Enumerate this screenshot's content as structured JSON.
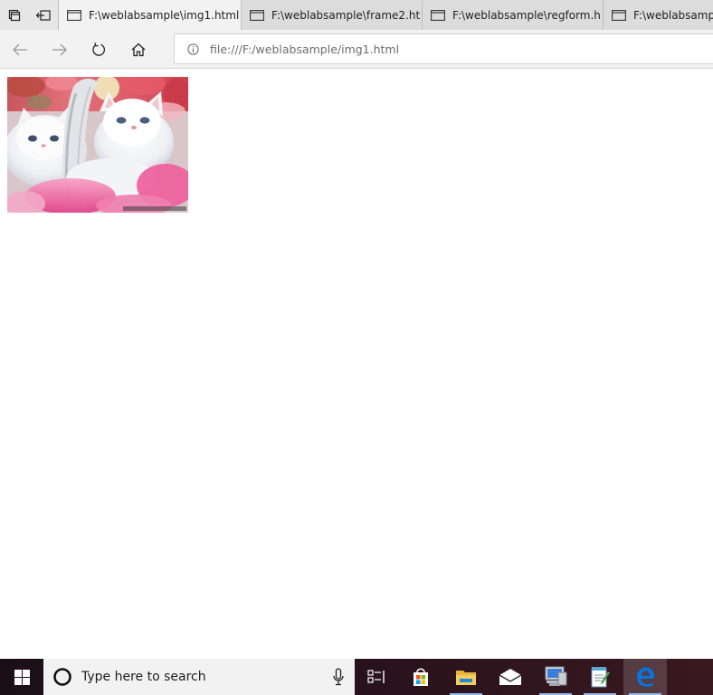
{
  "browser": {
    "tabs": [
      {
        "label": "F:\\weblabsample\\img1.html",
        "active": true
      },
      {
        "label": "F:\\weblabsample\\frame2.ht",
        "active": false
      },
      {
        "label": "F:\\weblabsample\\regform.h",
        "active": false
      },
      {
        "label": "F:\\weblabsamp",
        "active": false
      }
    ],
    "tab_strip_icons": [
      "tab-manager-icon",
      "set-aside-tabs-icon"
    ],
    "nav_icons": [
      "back-arrow-icon",
      "forward-arrow-icon",
      "refresh-icon",
      "home-icon"
    ],
    "address": {
      "icon": "info-icon",
      "url": "file:///F:/weblabsample/img1.html"
    }
  },
  "page": {
    "image": "white-kittens-in-basket"
  },
  "taskbar": {
    "search_placeholder": "Type here to search",
    "apps": [
      "task-view-icon",
      "store-icon",
      "file-explorer-icon",
      "mail-icon",
      "network-computer-icon",
      "notepad-icon",
      "edge-icon"
    ],
    "colors": {
      "accent": "#0078d7",
      "edge_blue": "#0a73d9"
    }
  }
}
